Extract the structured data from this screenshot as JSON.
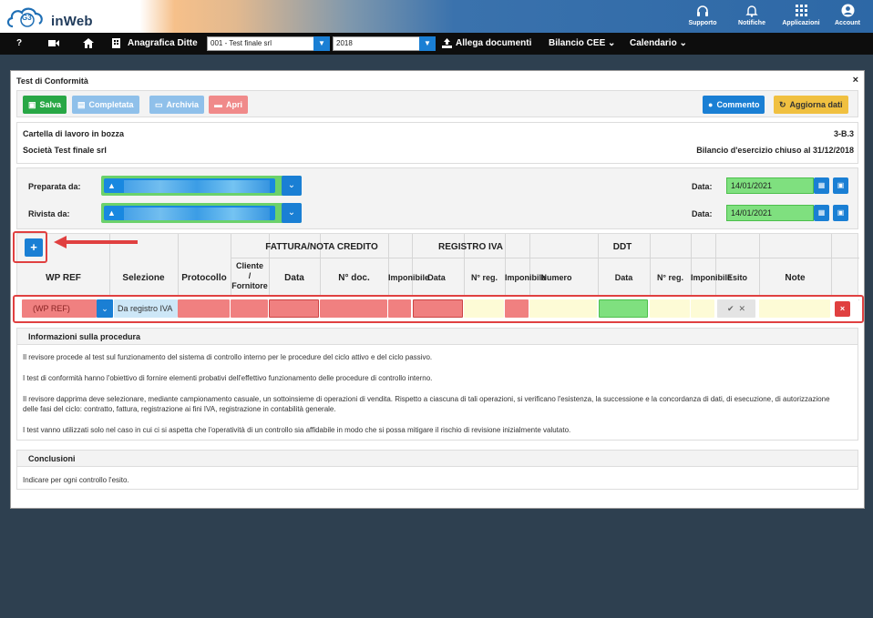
{
  "app": {
    "brand": "inWeb",
    "logo_text": "G3"
  },
  "top_actions": [
    {
      "label": "Supporto",
      "icon": "headset-icon"
    },
    {
      "label": "Notifiche",
      "icon": "bell-icon"
    },
    {
      "label": "Applicazioni",
      "icon": "grid-icon"
    },
    {
      "label": "Account",
      "icon": "user-icon"
    }
  ],
  "nav": {
    "help": "?",
    "anagrafica": "Anagrafica Ditte",
    "company_select": "001 - Test finale srl",
    "year_select": "2018",
    "allega": "Allega documenti",
    "bilancio": "Bilancio CEE",
    "calendario": "Calendario"
  },
  "modal": {
    "title": "Test di Conformità",
    "close": "×"
  },
  "toolbar": {
    "salva": "Salva",
    "completata": "Completata",
    "archivia": "Archivia",
    "apri": "Apri",
    "commento": "Commento",
    "aggiorna": "Aggiorna dati"
  },
  "info": {
    "status": "Cartella di lavoro in bozza",
    "code": "3-B.3",
    "company": "Società Test finale srl",
    "bilancio": "Bilancio d'esercizio chiuso al 31/12/2018"
  },
  "people": {
    "preparata_label": "Preparata da:",
    "rivista_label": "Rivista da:",
    "data_label": "Data:",
    "preparata_date": "14/01/2021",
    "rivista_date": "14/01/2021"
  },
  "grid": {
    "add": "+",
    "groups": {
      "fattura": "FATTURA/NOTA CREDITO",
      "registro": "REGISTRO IVA",
      "ddt": "DDT"
    },
    "cols": {
      "wpref": "WP REF",
      "selezione": "Selezione",
      "protocollo": "Protocollo",
      "cliente1": "Cliente",
      "cliente2": "/",
      "cliente3": "Fornitore",
      "data": "Data",
      "ndoc": "N° doc.",
      "imponibile": "Imponibile",
      "data2": "Data",
      "nreg": "N° reg.",
      "imponibile2": "Imponibile",
      "numero": "Numero",
      "data3": "Data",
      "nreg2": "N° reg.",
      "imponibile3": "Imponibile",
      "esito": "Esito",
      "note": "Note"
    },
    "row": {
      "wpref": "(WP REF)",
      "selezione": "Da registro IVA"
    }
  },
  "procedura": {
    "title": "Informazioni sulla procedura",
    "p1": "Il revisore procede al test sul funzionamento del sistema di controllo interno per le procedure del ciclo attivo e del ciclo passivo.",
    "p2": "I test di conformità hanno l'obiettivo di fornire elementi probativi dell'effettivo funzionamento delle procedure di controllo interno.",
    "p3": "Il revisore dapprima deve selezionare, mediante campionamento casuale, un sottoinsieme di operazioni di vendita. Rispetto a ciascuna di tali operazioni, si verificano l'esistenza, la successione e la concordanza di dati, di esecuzione, di autorizzazione delle fasi del ciclo: contratto, fattura, registrazione ai fini IVA, registrazione in contabilità generale.",
    "p4": "I test vanno utilizzati solo nel caso in cui ci si aspetta che l'operatività di un controllo sia affidabile in modo che si possa mitigare il rischio di revisione inizialmente valutato."
  },
  "conclusioni": {
    "title": "Conclusioni",
    "text": "Indicare per ogni controllo l'esito."
  },
  "colors": {
    "primary": "#1a7fd4",
    "success": "#28a745",
    "warning": "#f0c040",
    "danger": "#e04040",
    "valid": "#7fe07f",
    "invalid": "#f08080"
  }
}
